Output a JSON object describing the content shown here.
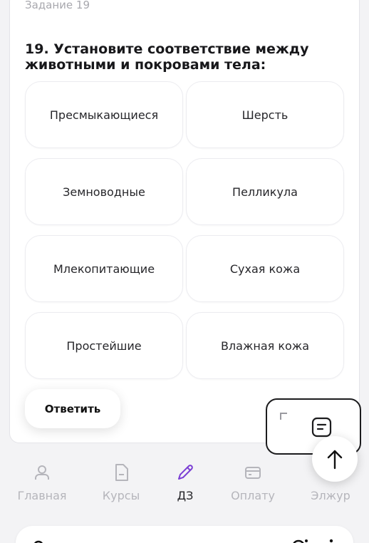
{
  "task": {
    "label": "Задание 19",
    "question": "19. Установите соответствие между животными и покровами тела:"
  },
  "options": {
    "left": [
      "Пресмыкающиеся",
      "Земноводные",
      "Млекопитающие",
      "Простейшие"
    ],
    "right": [
      "Шерсть",
      "Пелликула",
      "Сухая кожа",
      "Влажная кожа"
    ]
  },
  "answer_button": "Ответить",
  "nav": {
    "items": [
      {
        "label": "Главная",
        "icon": "user-icon"
      },
      {
        "label": "Курсы",
        "icon": "document-icon"
      },
      {
        "label": "ДЗ",
        "icon": "pencil-icon",
        "active": true
      },
      {
        "label": "Оплату",
        "icon": "wallet-icon"
      },
      {
        "label": "Элжур",
        "icon": "journal-icon"
      }
    ]
  },
  "colors": {
    "accent": "#7b3fd4",
    "inactive": "#b5b5bb",
    "background": "#f3f3f5"
  }
}
